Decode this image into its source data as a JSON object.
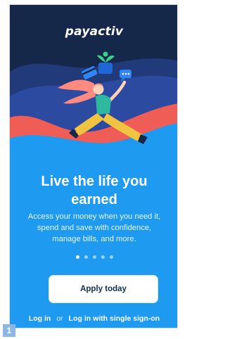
{
  "app": {
    "brand": "payactiv"
  },
  "onboarding": {
    "headline_line1": "Live the life you",
    "headline_line2": "earned",
    "sub_line1": "Access your money when you need it,",
    "sub_line2": "spend and save with confidence,",
    "sub_line3": "manage bills, and more.",
    "page_indicator": {
      "total": 5,
      "active_index": 0
    }
  },
  "actions": {
    "apply_label": "Apply today",
    "login_label": "Log in",
    "or_label": "or",
    "sso_label": "Log in with single sign-on"
  },
  "badge": {
    "label": "1"
  },
  "colors": {
    "background": "#1e9bf0",
    "hero_navy": "#15284a",
    "wave_red": "#ef5d57",
    "accent_yellow": "#f0c340",
    "button_text": "#0f2f57"
  }
}
